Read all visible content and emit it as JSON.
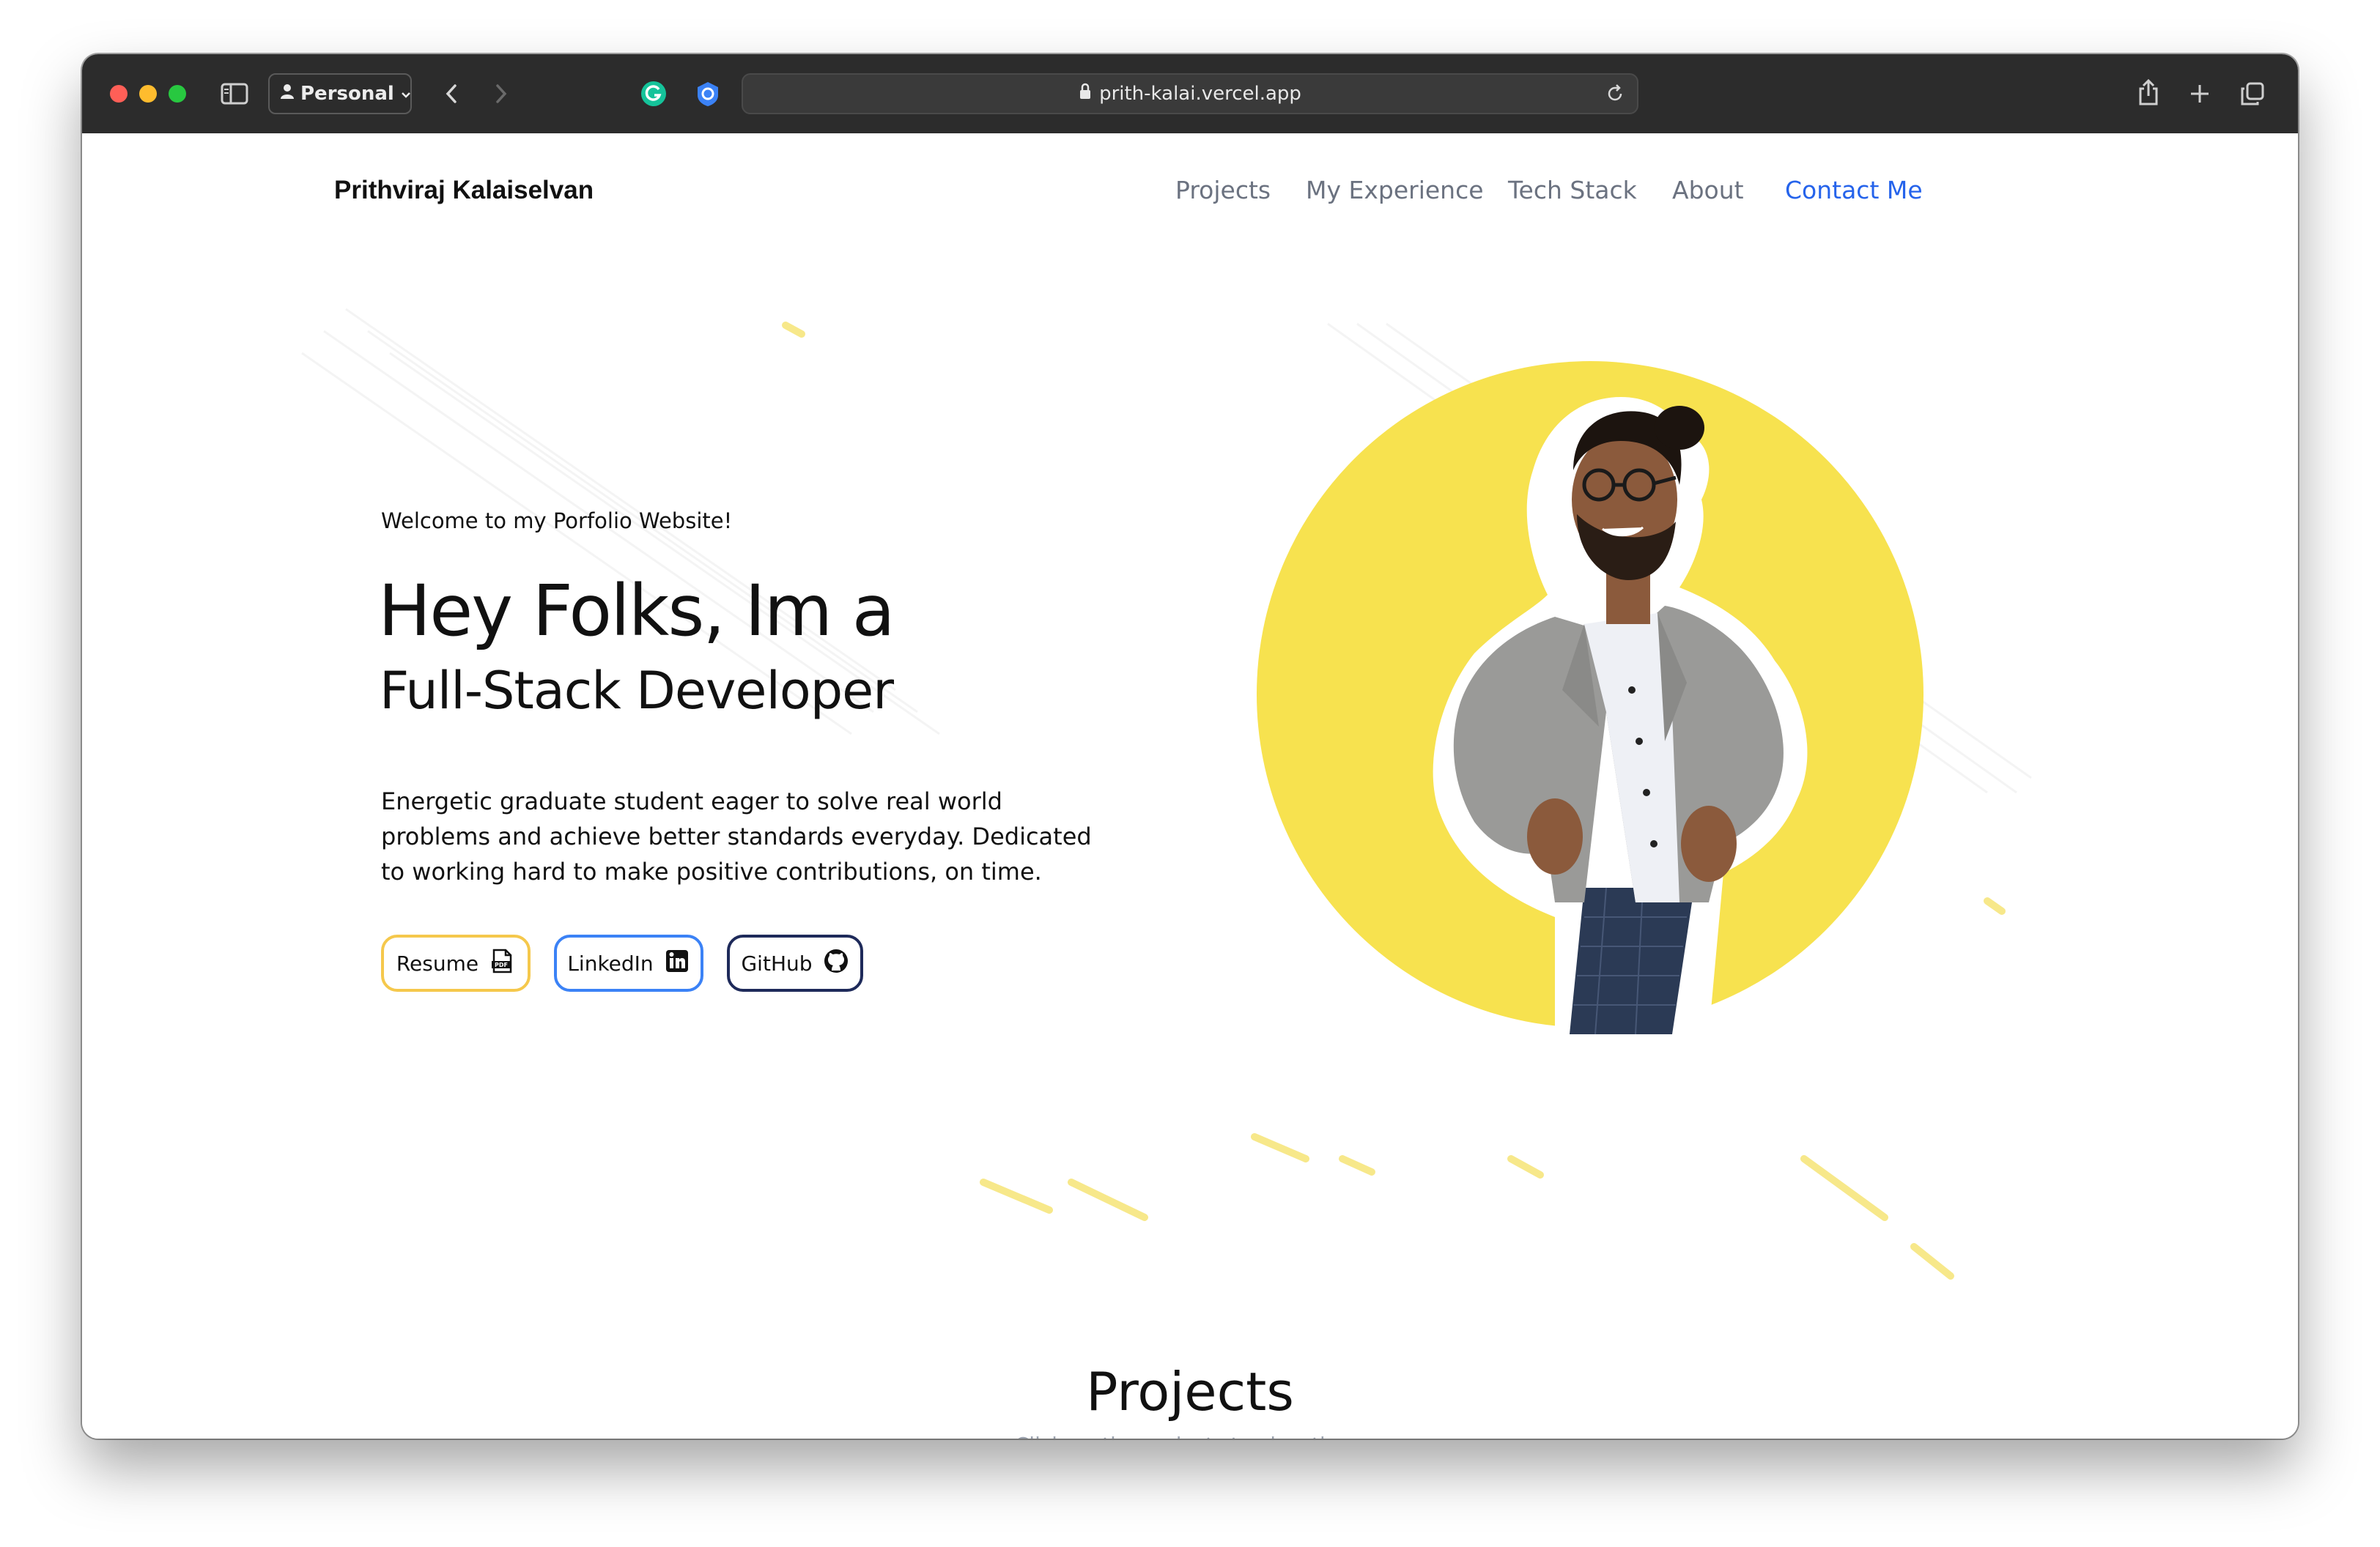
{
  "browser": {
    "profile_label": "Personal",
    "url": "prith-kalai.vercel.app",
    "icons": [
      "sidebar-icon",
      "person-icon",
      "chevron-down-icon",
      "back-icon",
      "forward-icon",
      "grammarly-icon",
      "shield-extension-icon",
      "lock-icon",
      "reload-icon",
      "share-icon",
      "new-tab-icon",
      "tab-overview-icon"
    ]
  },
  "header": {
    "brand": "Prithviraj Kalaiselvan",
    "nav": {
      "projects": "Projects",
      "experience": "My Experience",
      "tech_stack": "Tech Stack",
      "about": "About",
      "contact": "Contact Me"
    }
  },
  "hero": {
    "welcome": "Welcome to my Porfolio Website!",
    "headline": "Hey Folks, Im a",
    "role": "Full-Stack Developer",
    "description": "Energetic graduate student eager to solve real world problems and achieve better standards everyday. Dedicated to working hard to make positive contributions, on time.",
    "buttons": {
      "resume": "Resume",
      "linkedin": "LinkedIn",
      "github": "GitHub"
    }
  },
  "projects": {
    "title": "Projects",
    "subtitle": "Click on the projects to view them"
  },
  "colors": {
    "accent_yellow": "#f7e24f",
    "nav_active": "#2563eb",
    "linkedin_border": "#3b82f6",
    "github_border": "#1e2a5a",
    "resume_border": "#f5c84c",
    "toolbar_bg": "#2c2c2c"
  }
}
